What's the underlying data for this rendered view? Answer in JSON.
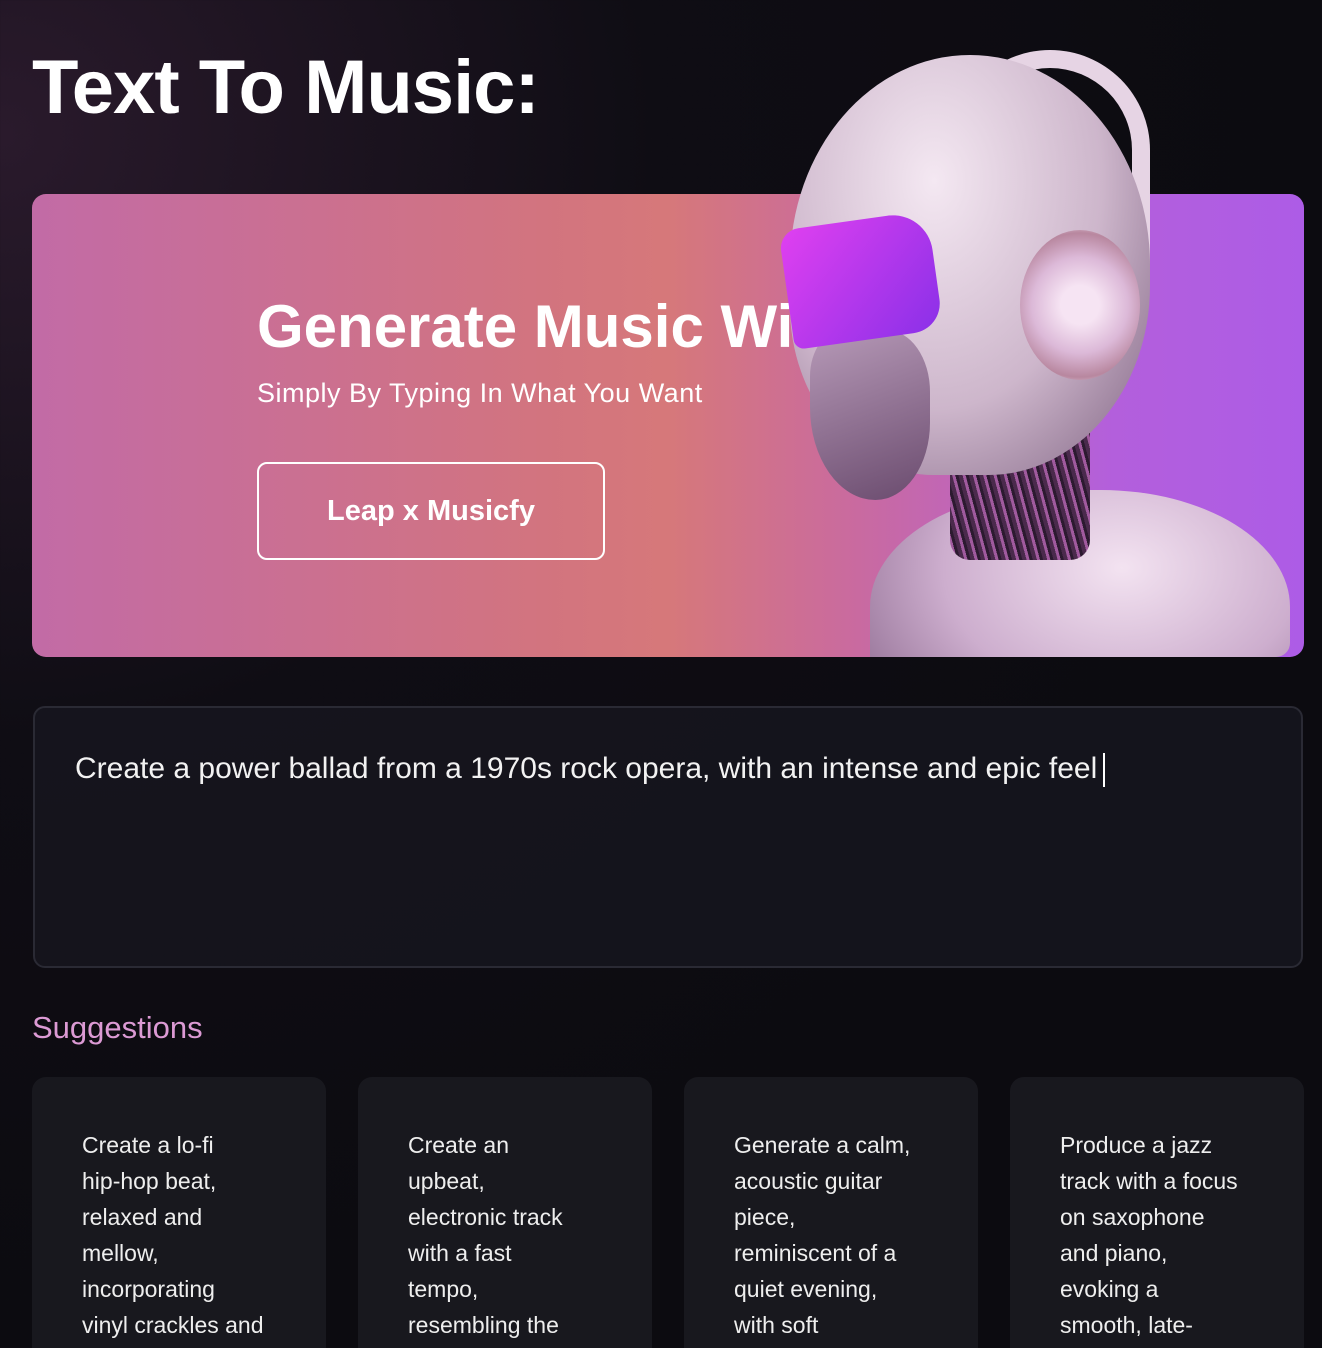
{
  "page": {
    "title": "Text To Music:"
  },
  "hero": {
    "heading": "Generate Music With AI",
    "subtitle": "Simply By Typing In What You Want",
    "button_label": "Leap x Musicfy",
    "gradient_colors": [
      "#c26ba6",
      "#d6787a",
      "#ad5ce6"
    ]
  },
  "prompt": {
    "value": "Create a power ballad from a 1970s rock opera, with an intense and epic feel"
  },
  "suggestions": {
    "label": "Suggestions",
    "items": [
      {
        "text": "Create a lo-fi\nhip-hop beat,\nrelaxed and\nmellow,\nincorporating\nvinyl crackles and"
      },
      {
        "text": "Create an\nupbeat,\nelectronic track\nwith a fast\ntempo,\nresembling the"
      },
      {
        "text": "Generate a calm,\nacoustic guitar\npiece,\nreminiscent of a\nquiet evening,\nwith soft"
      },
      {
        "text": "Produce a jazz\ntrack with a focus\non saxophone\nand piano,\nevoking a\nsmooth, late-"
      }
    ]
  }
}
